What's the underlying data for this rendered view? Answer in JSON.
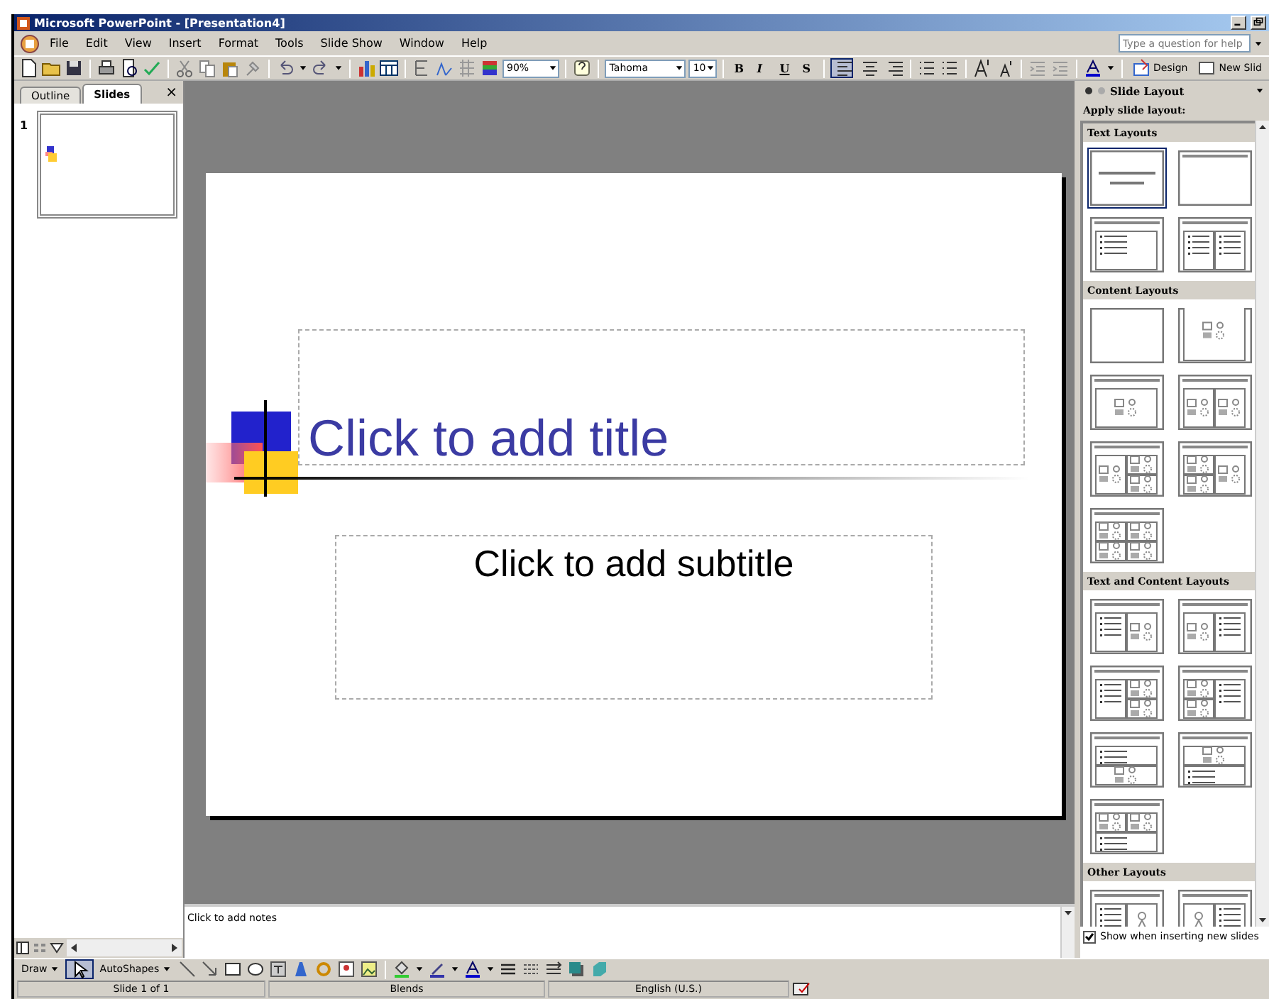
{
  "window": {
    "title": "Microsoft PowerPoint - [Presentation4]"
  },
  "menu": [
    "File",
    "Edit",
    "View",
    "Insert",
    "Format",
    "Tools",
    "Slide Show",
    "Window",
    "Help"
  ],
  "help_box": {
    "placeholder": "Type a question for help"
  },
  "toolbar": {
    "zoom": "90%",
    "font": "Tahoma",
    "font_size": "10",
    "style_buttons": [
      {
        "label": "B",
        "on": false
      },
      {
        "label": "I",
        "on": false
      },
      {
        "label": "U",
        "on": false
      },
      {
        "label": "S",
        "on": false
      }
    ],
    "alignment": [
      {
        "selected": true
      },
      {
        "selected": false
      },
      {
        "selected": false
      }
    ],
    "design": "Design",
    "new_slide": "New Slid"
  },
  "outline_pane": {
    "tabs": [
      {
        "label": "Outline",
        "selected": false
      },
      {
        "label": "Slides",
        "selected": true
      }
    ],
    "close": "×",
    "slides": [
      {
        "number": "1",
        "selected": true
      }
    ]
  },
  "slide": {
    "title_placeholder": "Click to add title",
    "subtitle_placeholder": "Click to add subtitle"
  },
  "notes": {
    "text": "Click to add notes"
  },
  "task_pane": {
    "title": "Slide Layout",
    "heading": "Apply slide layout:",
    "sections": [
      {
        "title": "Text Layouts",
        "layouts": [
          {
            "kind": "title",
            "selected": true
          },
          {
            "kind": "title-only",
            "selected": false
          },
          {
            "kind": "text",
            "selected": false
          },
          {
            "kind": "two-text",
            "selected": false
          }
        ]
      },
      {
        "title": "Content Layouts",
        "layouts": [
          {
            "kind": "blank",
            "selected": false
          },
          {
            "kind": "content",
            "selected": false
          },
          {
            "kind": "title-content",
            "selected": false
          },
          {
            "kind": "two-content",
            "selected": false
          },
          {
            "kind": "content-pair",
            "selected": false
          },
          {
            "kind": "pair-content",
            "selected": false
          },
          {
            "kind": "four-content",
            "selected": false
          }
        ]
      },
      {
        "title": "Text and Content Layouts",
        "layouts": [
          {
            "kind": "text-content",
            "selected": false
          },
          {
            "kind": "content-text",
            "selected": false
          },
          {
            "kind": "text-pair",
            "selected": false
          },
          {
            "kind": "pair-text",
            "selected": false
          },
          {
            "kind": "text-over-content",
            "selected": false
          },
          {
            "kind": "content-over-text",
            "selected": false
          },
          {
            "kind": "pair-over-text",
            "selected": false
          }
        ]
      },
      {
        "title": "Other Layouts",
        "layouts": [
          {
            "kind": "text-clipart",
            "selected": false
          },
          {
            "kind": "clipart-text",
            "selected": false
          }
        ]
      }
    ],
    "show_when_inserting": {
      "label": "Show when inserting new slides",
      "checked": true
    }
  },
  "draw_toolbar": {
    "draw": "Draw",
    "autoshapes": "AutoShapes"
  },
  "status_bar": [
    "Slide 1 of 1",
    "Blends",
    "English (U.S.)"
  ]
}
